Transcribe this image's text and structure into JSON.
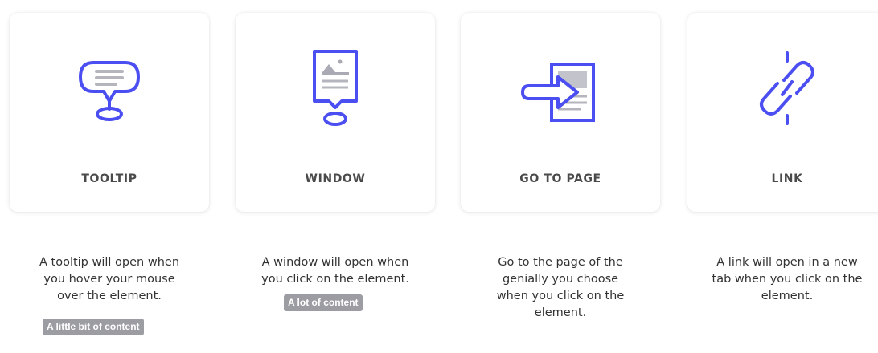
{
  "accent_color": "#4b4ef0",
  "options": [
    {
      "label": "TOOLTIP",
      "icon": "tooltip-bubble-icon",
      "description_lines": [
        "A tooltip will open when",
        "you hover your mouse",
        "over the element."
      ],
      "badge": "A little bit of content"
    },
    {
      "label": "WINDOW",
      "icon": "window-popup-icon",
      "description_lines": [
        "A window will open when",
        "you click on the element."
      ],
      "badge": "A lot of content"
    },
    {
      "label": "GO TO PAGE",
      "icon": "go-to-page-icon",
      "description_lines": [
        "Go to the page of the",
        "genially you choose",
        "when you click on the",
        "element."
      ]
    },
    {
      "label": "LINK",
      "icon": "link-chain-icon",
      "description_lines": [
        "A link will open in a new",
        "tab when you click on the",
        "element."
      ]
    }
  ]
}
